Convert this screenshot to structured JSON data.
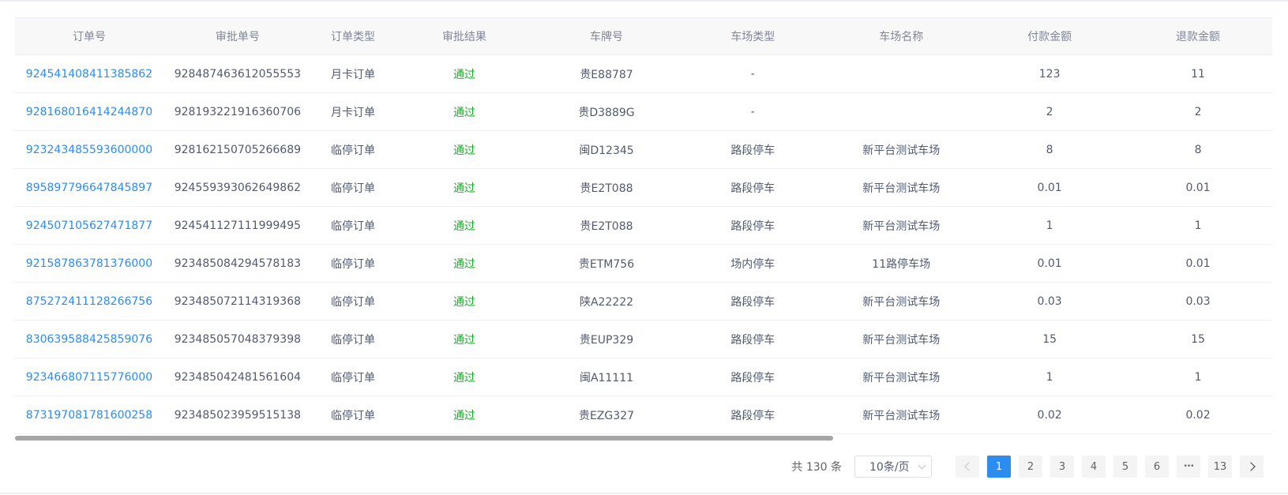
{
  "table": {
    "columns": [
      "订单号",
      "审批单号",
      "订单类型",
      "审批结果",
      "车牌号",
      "车场类型",
      "车场名称",
      "付款金额",
      "退款金额"
    ],
    "rows": [
      {
        "order_no": "924541408411385862",
        "approval_no": "928487463612055553",
        "order_type": "月卡订单",
        "result": "通过",
        "plate": "贵E88787",
        "lot_type": "-",
        "lot_name": "",
        "paid": "123",
        "refund": "11"
      },
      {
        "order_no": "928168016414244870",
        "approval_no": "928193221916360706",
        "order_type": "月卡订单",
        "result": "通过",
        "plate": "贵D3889G",
        "lot_type": "-",
        "lot_name": "",
        "paid": "2",
        "refund": "2"
      },
      {
        "order_no": "923243485593600000",
        "approval_no": "928162150705266689",
        "order_type": "临停订单",
        "result": "通过",
        "plate": "闽D12345",
        "lot_type": "路段停车",
        "lot_name": "新平台测试车场",
        "paid": "8",
        "refund": "8"
      },
      {
        "order_no": "895897796647845897",
        "approval_no": "924559393062649862",
        "order_type": "临停订单",
        "result": "通过",
        "plate": "贵E2T088",
        "lot_type": "路段停车",
        "lot_name": "新平台测试车场",
        "paid": "0.01",
        "refund": "0.01"
      },
      {
        "order_no": "924507105627471877",
        "approval_no": "924541127111999495",
        "order_type": "临停订单",
        "result": "通过",
        "plate": "贵E2T088",
        "lot_type": "路段停车",
        "lot_name": "新平台测试车场",
        "paid": "1",
        "refund": "1"
      },
      {
        "order_no": "921587863781376000",
        "approval_no": "923485084294578183",
        "order_type": "临停订单",
        "result": "通过",
        "plate": "贵ETM756",
        "lot_type": "场内停车",
        "lot_name": "11路停车场",
        "paid": "0.01",
        "refund": "0.01"
      },
      {
        "order_no": "875272411128266756",
        "approval_no": "923485072114319368",
        "order_type": "临停订单",
        "result": "通过",
        "plate": "陕A22222",
        "lot_type": "路段停车",
        "lot_name": "新平台测试车场",
        "paid": "0.03",
        "refund": "0.03"
      },
      {
        "order_no": "830639588425859076",
        "approval_no": "923485057048379398",
        "order_type": "临停订单",
        "result": "通过",
        "plate": "贵EUP329",
        "lot_type": "路段停车",
        "lot_name": "新平台测试车场",
        "paid": "15",
        "refund": "15"
      },
      {
        "order_no": "923466807115776000",
        "approval_no": "923485042481561604",
        "order_type": "临停订单",
        "result": "通过",
        "plate": "闽A11111",
        "lot_type": "路段停车",
        "lot_name": "新平台测试车场",
        "paid": "1",
        "refund": "1"
      },
      {
        "order_no": "873197081781600258",
        "approval_no": "923485023959515138",
        "order_type": "临停订单",
        "result": "通过",
        "plate": "贵EZG327",
        "lot_type": "路段停车",
        "lot_name": "新平台测试车场",
        "paid": "0.02",
        "refund": "0.02"
      }
    ]
  },
  "pagination": {
    "total_label": "共 130 条",
    "page_size": "10条/页",
    "pages": [
      "1",
      "2",
      "3",
      "4",
      "5",
      "6"
    ],
    "ellipsis": "•••",
    "last_page": "13",
    "current_page": "1"
  },
  "colors": {
    "link": "#2d8cf0",
    "success": "#19aa2c",
    "active_page": "#2d8cf0"
  }
}
